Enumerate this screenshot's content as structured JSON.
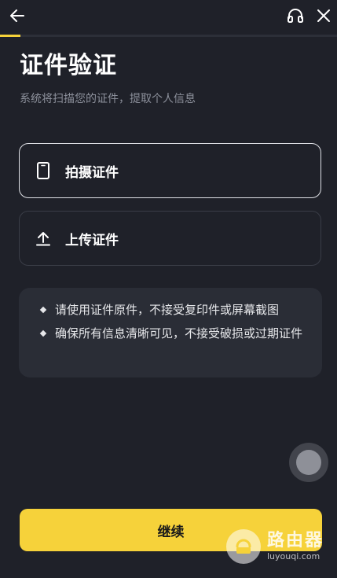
{
  "topbar": {
    "back_icon": "arrow-left-icon",
    "support_icon": "headset-icon",
    "close_icon": "close-icon"
  },
  "progress": {
    "fraction": 0.06,
    "color": "#f6d23a"
  },
  "header": {
    "title": "证件验证",
    "subtitle": "系统将扫描您的证件，提取个人信息"
  },
  "options": [
    {
      "label": "拍摄证件",
      "icon": "phone-icon",
      "selected": true
    },
    {
      "label": "上传证件",
      "icon": "upload-icon",
      "selected": false
    }
  ],
  "tips": [
    "请使用证件原件，不接受复印件或屏幕截图",
    "确保所有信息清晰可见，不接受破损或过期证件"
  ],
  "footer": {
    "continue_label": "继续"
  },
  "watermark": {
    "title": "路由器",
    "url": "luyouqi.com"
  },
  "colors": {
    "background": "#1f2129",
    "accent": "#f6d23a",
    "card_border_selected": "#dfe1e6",
    "card_border": "#3a3d47",
    "tips_background": "#2a2d36"
  }
}
